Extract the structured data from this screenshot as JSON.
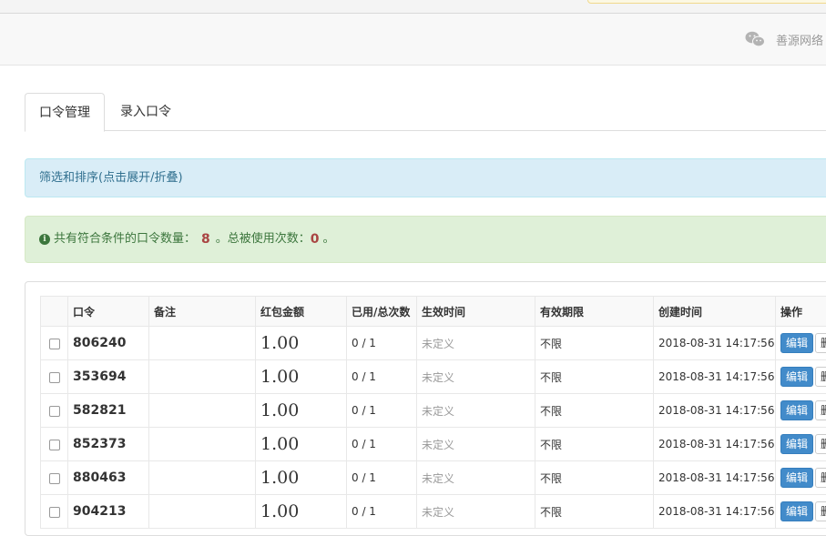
{
  "header": {
    "brand_text": "善源网络"
  },
  "tabs": [
    {
      "label": "口令管理",
      "active": true
    },
    {
      "label": "录入口令",
      "active": false
    }
  ],
  "filter": {
    "label": "筛选和排序(点击展开/折叠)"
  },
  "summary": {
    "prefix": "共有符合条件的口令数量：",
    "count": "8",
    "middle": "。总被使用次数：",
    "used": "0",
    "suffix": "。"
  },
  "table": {
    "headers": [
      "",
      "口令",
      "备注",
      "红包金额",
      "已用/总次数",
      "生效时间",
      "有效期限",
      "创建时间",
      "操作"
    ],
    "rows": [
      {
        "code": "806240",
        "note": "",
        "amount": "1.00",
        "used": "0 / 1",
        "start": "未定义",
        "validity": "不限",
        "created": "2018-08-31 14:17:56"
      },
      {
        "code": "353694",
        "note": "",
        "amount": "1.00",
        "used": "0 / 1",
        "start": "未定义",
        "validity": "不限",
        "created": "2018-08-31 14:17:56"
      },
      {
        "code": "582821",
        "note": "",
        "amount": "1.00",
        "used": "0 / 1",
        "start": "未定义",
        "validity": "不限",
        "created": "2018-08-31 14:17:56"
      },
      {
        "code": "852373",
        "note": "",
        "amount": "1.00",
        "used": "0 / 1",
        "start": "未定义",
        "validity": "不限",
        "created": "2018-08-31 14:17:56"
      },
      {
        "code": "880463",
        "note": "",
        "amount": "1.00",
        "used": "0 / 1",
        "start": "未定义",
        "validity": "不限",
        "created": "2018-08-31 14:17:56"
      },
      {
        "code": "904213",
        "note": "",
        "amount": "1.00",
        "used": "0 / 1",
        "start": "未定义",
        "validity": "不限",
        "created": "2018-08-31 14:17:56"
      }
    ],
    "edit_label": "编辑",
    "delete_label": "删"
  },
  "colors": {
    "primary_button": "#428bca",
    "info_bg": "#d9edf7",
    "success_bg": "#dff0d8",
    "count_highlight": "#a94442"
  }
}
